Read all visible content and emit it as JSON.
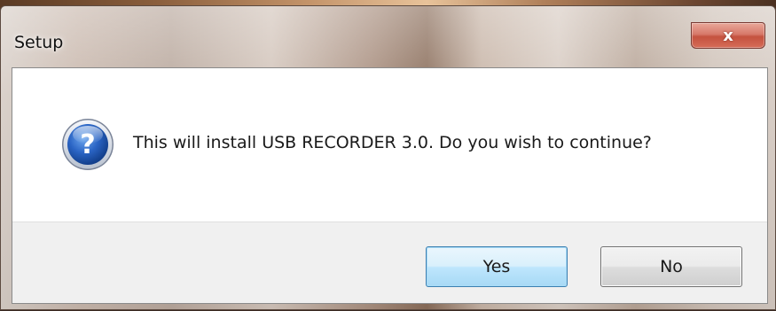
{
  "window": {
    "title": "Setup",
    "close_glyph": "x",
    "close_icon": "close-icon"
  },
  "dialog": {
    "icon": "question-icon",
    "icon_glyph": "?",
    "message": "This will install USB RECORDER 3.0. Do you wish to continue?"
  },
  "buttons": {
    "yes_label": "Yes",
    "no_label": "No"
  },
  "colors": {
    "default_button_border": "#3c7fb1",
    "close_button": "#c4523f",
    "icon_blue": "#1f5fb8"
  }
}
